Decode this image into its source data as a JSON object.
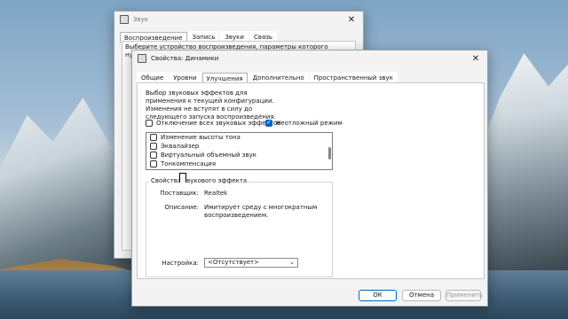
{
  "back_window": {
    "title": "Звук",
    "tabs": [
      "Воспроизведение",
      "Запись",
      "Звуки",
      "Связь"
    ],
    "description": "Выберите устройство воспроизведения, параметры которого нужно"
  },
  "front_window": {
    "title": "Свойства: Динамики",
    "tabs": [
      "Общие",
      "Уровни",
      "Улучшения",
      "Дополнительно",
      "Пространственный звук"
    ],
    "active_tab": "Улучшения",
    "intro": "Выбор звуковых эффектов для применения к текущей конфигурации. Изменения не вступят в силу до следующего запуска воспроизведения.",
    "disable_all_label": "Отключение всех звуковых эффектов",
    "immediate_mode_label": "Неотложный режим",
    "immediate_mode_checked": true,
    "effects": [
      {
        "label": "Изменение высоты тона",
        "checked": false
      },
      {
        "label": "Эквалайзер",
        "checked": false
      },
      {
        "label": "Виртуальный объемный звук",
        "checked": false
      },
      {
        "label": "Тонкомпенсация",
        "checked": false
      }
    ],
    "effect_props": {
      "group_title": "Свойства звукового эффекта",
      "provider_label": "Поставщик:",
      "provider_value": "Realtek",
      "description_label": "Описание:",
      "description_value": "Имитирует среду с многократным воспроизведением.",
      "setting_label": "Настройка:",
      "setting_value": "<Отсутствует>"
    },
    "buttons": {
      "ok": "ОК",
      "cancel": "Отмена",
      "apply": "Применить"
    }
  },
  "colors": {
    "accent": "#0067c0"
  }
}
